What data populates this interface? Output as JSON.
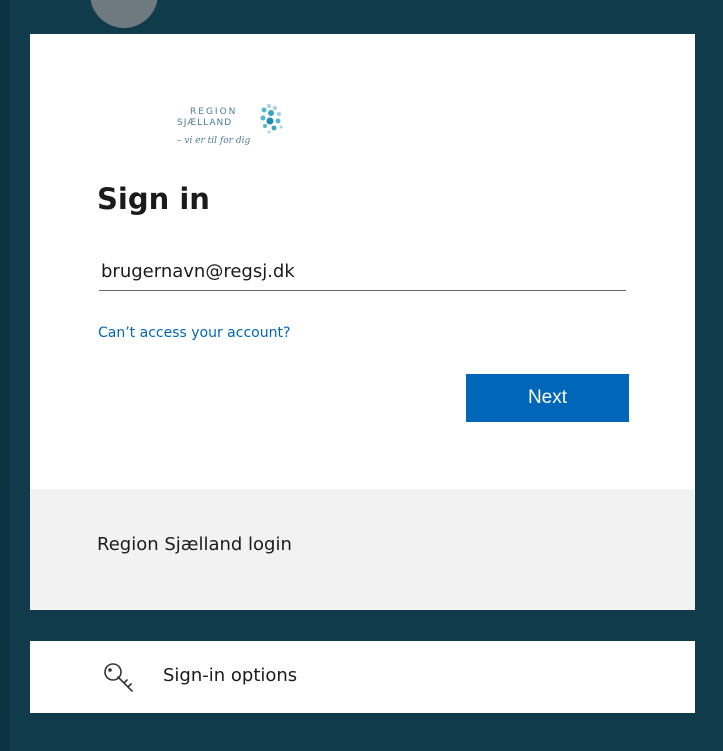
{
  "logo": {
    "line1": "REGION",
    "line2": "SJÆLLAND",
    "tagline": "– vi er til for dig"
  },
  "signin": {
    "title": "Sign in",
    "email_value": "brugernavn@regsj.dk",
    "cant_access_label": "Can’t access your account?",
    "next_label": "Next"
  },
  "footer": {
    "text": "Region Sjælland login"
  },
  "options": {
    "label": "Sign-in options",
    "icon": "key-icon"
  },
  "colors": {
    "background": "#0f3b4a",
    "accent": "#0067b8",
    "card": "#ffffff",
    "footer_band": "#f2f2f2"
  }
}
